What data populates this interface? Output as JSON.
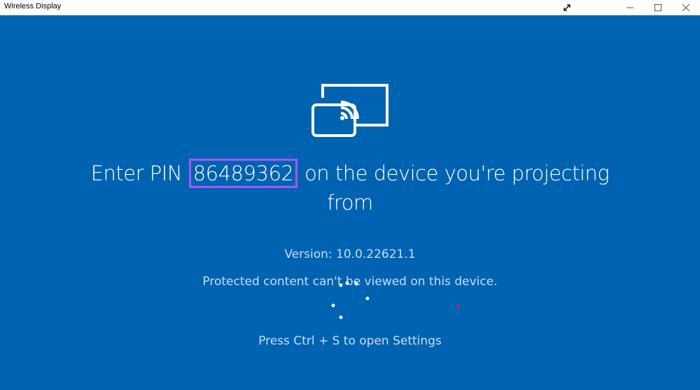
{
  "window": {
    "title": "Wireless Display",
    "buttons": {
      "fullscreen": "expand-icon",
      "minimize": "minimize-icon",
      "maximize": "maximize-icon",
      "close": "close-icon"
    }
  },
  "main": {
    "icon": "cast-icon",
    "pin_prefix": "Enter PIN",
    "pin": "86489362",
    "pin_suffix": "on the device you're projecting from",
    "pin_highlight_color": "#a855f7",
    "version": "Version: 10.0.22621.1",
    "protected_notice": "Protected content can't be viewed on this device.",
    "settings_hint": "Press Ctrl + S to open Settings"
  },
  "colors": {
    "background": "#0063b1",
    "text": "#ffffff",
    "secondary_text": "#c9dcf0"
  }
}
